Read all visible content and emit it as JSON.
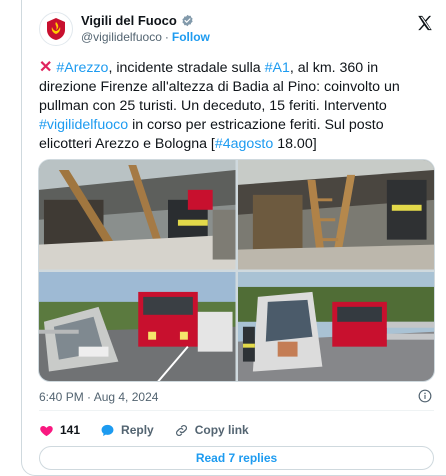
{
  "tweet": {
    "author": {
      "name": "Vigili del Fuoco",
      "handle": "@vigilidelfuoco",
      "separator": "·",
      "follow_label": "Follow",
      "verified": true
    },
    "text": {
      "p1_link1": "#Arezzo",
      "p1_text1": ", incidente stradale sulla ",
      "p1_link2": "#A1",
      "p1_text2": ", al km. 360 in direzione Firenze all'altezza di Badia al Pino: coinvolto un pullman con 25 turisti. Un deceduto, 15 feriti. Intervento ",
      "p1_link3": "#vigilidelfuoco",
      "p1_text3": " in corso per estricazione feriti. Sul posto elicotteri Arezzo e Bologna [",
      "p1_link4": "#4agosto",
      "p1_text4": " 18.00]"
    },
    "timestamp": "6:40 PM · Aug 4, 2024",
    "actions": {
      "likes": "141",
      "reply_label": "Reply",
      "copy_label": "Copy link"
    },
    "read_replies_label": "Read 7 replies"
  },
  "colors": {
    "link": "#1d9bf0",
    "like": "#f91880",
    "text": "#0f1419",
    "muted": "#536471",
    "fire_red": "#c8102e"
  },
  "icons": [
    "avatar-logo-icon",
    "verified-badge-icon",
    "x-logo-icon",
    "red-cross-mark-icon",
    "info-icon",
    "heart-icon",
    "reply-icon",
    "link-icon"
  ]
}
